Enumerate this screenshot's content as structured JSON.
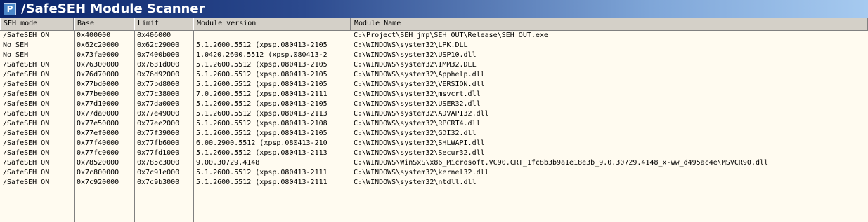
{
  "window": {
    "title": "/SafeSEH Module Scanner",
    "icon": "app-icon"
  },
  "columns": [
    "SEH mode",
    "Base",
    "Limit",
    "Module version",
    "Module Name"
  ],
  "rows": [
    [
      "/SafeSEH ON",
      "0x400000",
      "0x406000",
      "",
      "C:\\Project\\SEH_jmp\\SEH_OUT\\Release\\SEH_OUT.exe"
    ],
    [
      "No SEH",
      "0x62c20000",
      "0x62c29000",
      "5.1.2600.5512 (xpsp.080413-2105",
      "C:\\WINDOWS\\system32\\LPK.DLL"
    ],
    [
      "No SEH",
      "0x73fa0000",
      "0x7400b000",
      "1.0420.2600.5512 (xpsp.080413-2",
      "C:\\WINDOWS\\system32\\USP10.dll"
    ],
    [
      "/SafeSEH ON",
      "0x76300000",
      "0x7631d000",
      "5.1.2600.5512 (xpsp.080413-2105",
      "C:\\WINDOWS\\system32\\IMM32.DLL"
    ],
    [
      "/SafeSEH ON",
      "0x76d70000",
      "0x76d92000",
      "5.1.2600.5512 (xpsp.080413-2105",
      "C:\\WINDOWS\\system32\\Apphelp.dll"
    ],
    [
      "/SafeSEH ON",
      "0x77bd0000",
      "0x77bd8000",
      "5.1.2600.5512 (xpsp.080413-2105",
      "C:\\WINDOWS\\system32\\VERSION.dll"
    ],
    [
      "/SafeSEH ON",
      "0x77be0000",
      "0x77c38000",
      "7.0.2600.5512 (xpsp.080413-2111",
      "C:\\WINDOWS\\system32\\msvcrt.dll"
    ],
    [
      "/SafeSEH ON",
      "0x77d10000",
      "0x77da0000",
      "5.1.2600.5512 (xpsp.080413-2105",
      "C:\\WINDOWS\\system32\\USER32.dll"
    ],
    [
      "/SafeSEH ON",
      "0x77da0000",
      "0x77e49000",
      "5.1.2600.5512 (xpsp.080413-2113",
      "C:\\WINDOWS\\system32\\ADVAPI32.dll"
    ],
    [
      "/SafeSEH ON",
      "0x77e50000",
      "0x77ee2000",
      "5.1.2600.5512 (xpsp.080413-2108",
      "C:\\WINDOWS\\system32\\RPCRT4.dll"
    ],
    [
      "/SafeSEH ON",
      "0x77ef0000",
      "0x77f39000",
      "5.1.2600.5512 (xpsp.080413-2105",
      "C:\\WINDOWS\\system32\\GDI32.dll"
    ],
    [
      "/SafeSEH ON",
      "0x77f40000",
      "0x77fb6000",
      "6.00.2900.5512 (xpsp.080413-210",
      "C:\\WINDOWS\\system32\\SHLWAPI.dll"
    ],
    [
      "/SafeSEH ON",
      "0x77fc0000",
      "0x77fd1000",
      "5.1.2600.5512 (xpsp.080413-2113",
      "C:\\WINDOWS\\system32\\Secur32.dll"
    ],
    [
      "/SafeSEH ON",
      "0x78520000",
      "0x785c3000",
      "9.00.30729.4148",
      "C:\\WINDOWS\\WinSxS\\x86_Microsoft.VC90.CRT_1fc8b3b9a1e18e3b_9.0.30729.4148_x-ww_d495ac4e\\MSVCR90.dll"
    ],
    [
      "/SafeSEH ON",
      "0x7c800000",
      "0x7c91e000",
      "5.1.2600.5512 (xpsp.080413-2111",
      "C:\\WINDOWS\\system32\\kernel32.dll"
    ],
    [
      "/SafeSEH ON",
      "0x7c920000",
      "0x7c9b3000",
      "5.1.2600.5512 (xpsp.080413-2111",
      "C:\\WINDOWS\\system32\\ntdll.dll"
    ]
  ]
}
